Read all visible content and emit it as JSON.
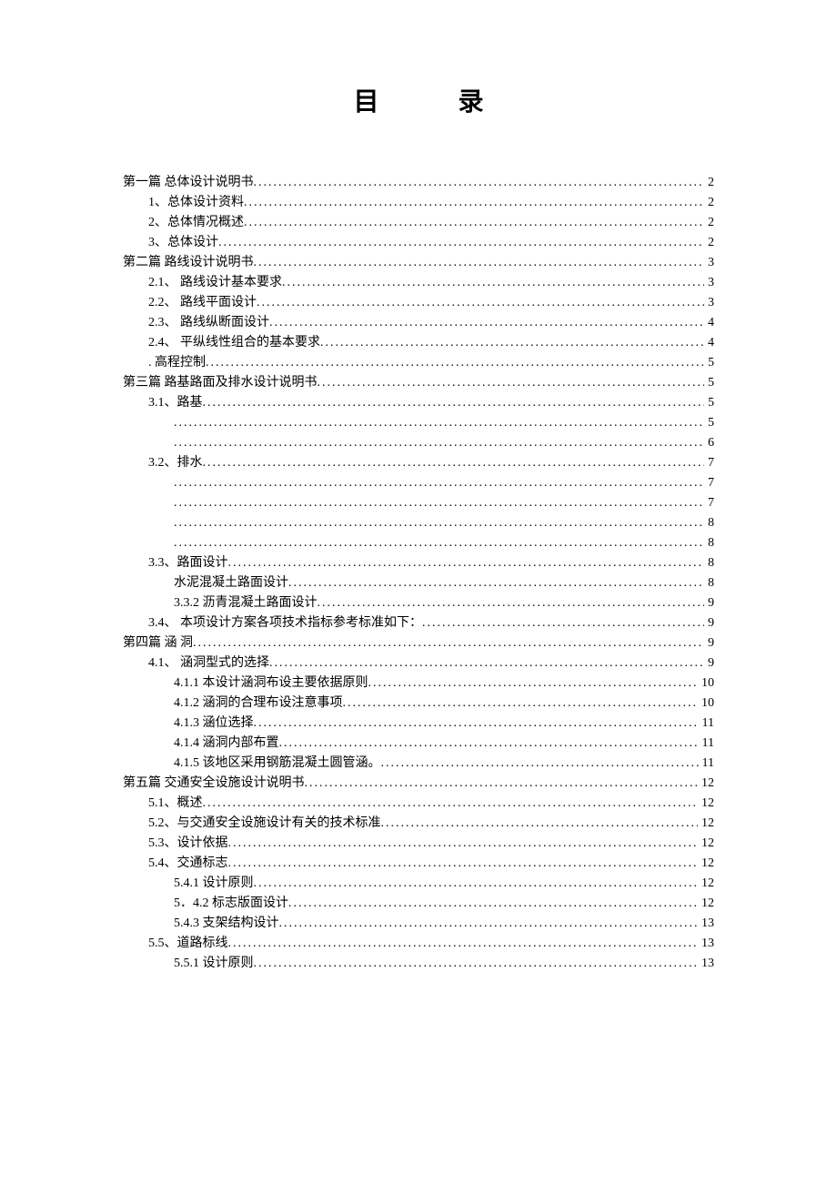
{
  "title": "目 录",
  "toc": [
    {
      "label": "第一篇  总体设计说明书",
      "page": "2",
      "level": 0
    },
    {
      "label": "1、总体设计资料",
      "page": "2",
      "level": 1
    },
    {
      "label": "2、总体情况概述",
      "page": "2",
      "level": 1
    },
    {
      "label": "3、总体设计",
      "page": "2",
      "level": 1
    },
    {
      "label": "第二篇  路线设计说明书",
      "page": "3",
      "level": 0
    },
    {
      "label": "2.1、 路线设计基本要求",
      "page": "3",
      "level": 1
    },
    {
      "label": "2.2、 路线平面设计",
      "page": "3",
      "level": 1
    },
    {
      "label": "2.3、 路线纵断面设计",
      "page": "4",
      "level": 1
    },
    {
      "label": "2.4、 平纵线性组合的基本要求",
      "page": "4",
      "level": 1
    },
    {
      "label": ". 高程控制",
      "page": "5",
      "level": 1
    },
    {
      "label": "第三篇  路基路面及排水设计说明书",
      "page": "5",
      "level": 0
    },
    {
      "label": "3.1、路基",
      "page": "5",
      "level": 1
    },
    {
      "label": "",
      "page": "5",
      "level": 2
    },
    {
      "label": "",
      "page": "6",
      "level": 2
    },
    {
      "label": "3.2、排水",
      "page": "7",
      "level": 1
    },
    {
      "label": "",
      "page": "7",
      "level": 2
    },
    {
      "label": "",
      "page": "7",
      "level": 2
    },
    {
      "label": "",
      "page": "8",
      "level": 2
    },
    {
      "label": "",
      "page": "8",
      "level": 2
    },
    {
      "label": "3.3、路面设计",
      "page": "8",
      "level": 1
    },
    {
      "label": "水泥混凝土路面设计",
      "page": "8",
      "level": 2
    },
    {
      "label": "3.3.2 沥青混凝土路面设计",
      "page": "9",
      "level": 2
    },
    {
      "label": "3.4、 本项设计方案各项技术指标参考标准如下：",
      "page": "9",
      "level": 1
    },
    {
      "label": "第四篇  涵 洞",
      "page": "9",
      "level": 0
    },
    {
      "label": "4.1、 涵洞型式的选择",
      "page": "9",
      "level": 1
    },
    {
      "label": "4.1.1 本设计涵洞布设主要依据原则",
      "page": "10",
      "level": 2
    },
    {
      "label": "4.1.2 涵洞的合理布设注意事项",
      "page": "10",
      "level": 2
    },
    {
      "label": "4.1.3 涵位选择",
      "page": "11",
      "level": 2
    },
    {
      "label": "4.1.4 涵洞内部布置",
      "page": "11",
      "level": 2
    },
    {
      "label": "4.1.5 该地区采用钢筋混凝土圆管涵。",
      "page": "11",
      "level": 2
    },
    {
      "label": "第五篇  交通安全设施设计说明书",
      "page": "12",
      "level": 0
    },
    {
      "label": "5.1、概述",
      "page": "12",
      "level": 1
    },
    {
      "label": "5.2、与交通安全设施设计有关的技术标准",
      "page": "12",
      "level": 1
    },
    {
      "label": "5.3、设计依据",
      "page": "12",
      "level": 1
    },
    {
      "label": "5.4、交通标志",
      "page": "12",
      "level": 1
    },
    {
      "label": "5.4.1 设计原则",
      "page": "12",
      "level": 2
    },
    {
      "label": "5．4.2 标志版面设计",
      "page": "12",
      "level": 2
    },
    {
      "label": "5.4.3 支架结构设计",
      "page": "13",
      "level": 2
    },
    {
      "label": "5.5、道路标线",
      "page": "13",
      "level": 1
    },
    {
      "label": "5.5.1 设计原则",
      "page": "13",
      "level": 2
    }
  ]
}
